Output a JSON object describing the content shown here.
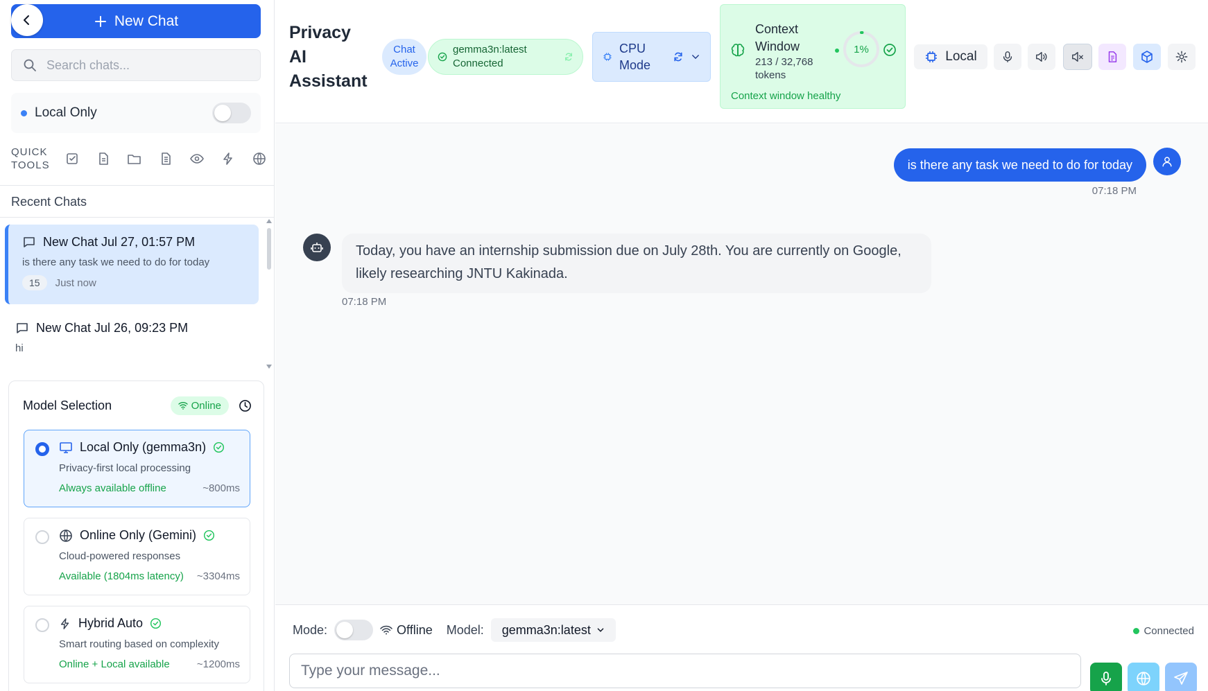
{
  "sidebar": {
    "new_chat_label": "New Chat",
    "search_placeholder": "Search chats...",
    "local_only_label": "Local Only",
    "quick_tools_label_1": "QUICK",
    "quick_tools_label_2": "TOOLS",
    "quick_tools": [
      "checkbox-icon",
      "document-icon",
      "folder-icon",
      "file-text-icon",
      "eye-icon",
      "lightning-icon",
      "globe-icon"
    ],
    "recent_chats_title": "Recent Chats",
    "chats": [
      {
        "title": "New Chat Jul 27, 01:57 PM",
        "preview": "is there any task we need to do for today",
        "count": "15",
        "time": "Just now"
      },
      {
        "title": "New Chat Jul 26, 09:23 PM",
        "preview": "hi"
      }
    ]
  },
  "model_selection": {
    "title": "Model Selection",
    "status": "Online",
    "options": [
      {
        "name": "Local Only (gemma3n)",
        "desc": "Privacy-first local processing",
        "availability": "Always available offline",
        "latency": "~800ms",
        "selected": true
      },
      {
        "name": "Online Only (Gemini)",
        "desc": "Cloud-powered responses",
        "availability": "Available (1804ms latency)",
        "latency": "~3304ms",
        "selected": false
      },
      {
        "name": "Hybrid Auto",
        "desc": "Smart routing based on complexity",
        "availability": "Online + Local available",
        "latency": "~1200ms",
        "selected": false
      }
    ]
  },
  "header": {
    "title_1": "Privacy",
    "title_2": "AI",
    "title_3": "Assistant",
    "chat_status_1": "Chat",
    "chat_status_2": "Active",
    "model_name": "gemma3n:latest",
    "model_status": "Connected",
    "cpu_mode_1": "CPU",
    "cpu_mode_2": "Mode",
    "context": {
      "title_1": "Context",
      "title_2": "Window",
      "tokens_1": "213 / 32,768",
      "tokens_2": "tokens",
      "percent": "1%",
      "usage_fraction": 0.01,
      "status": "Context window healthy"
    },
    "local_label": "Local"
  },
  "messages": [
    {
      "role": "user",
      "text": "is there any task we need to do for today",
      "time": "07:18 PM"
    },
    {
      "role": "assistant",
      "text": "Today, you have an internship submission due on July 28th. You are currently on Google, likely researching JNTU Kakinada.",
      "time": "07:18 PM"
    }
  ],
  "input_bar": {
    "mode_label": "Mode:",
    "mode_value": "Offline",
    "model_label": "Model:",
    "model_value": "gemma3n:latest",
    "connection": "Connected",
    "placeholder": "Type your message..."
  },
  "colors": {
    "primary": "#2563eb",
    "success": "#16a34a",
    "context_bg": "#dcfce7"
  }
}
